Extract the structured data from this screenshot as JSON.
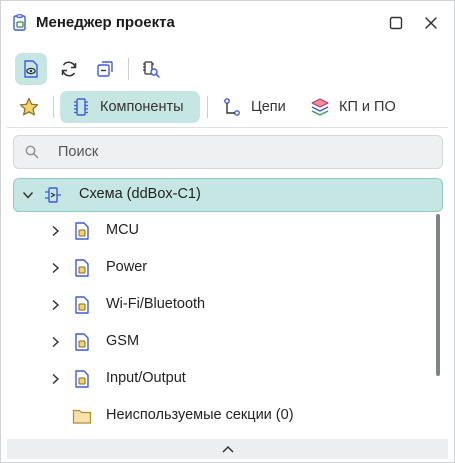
{
  "window": {
    "title": "Менеджер проекта",
    "icons": {
      "app": "project-manager-icon",
      "maximize": "maximize-icon",
      "close": "close-icon"
    }
  },
  "toolbar": {
    "buttons": [
      {
        "name": "view-document-button",
        "icon": "document-eye-icon",
        "active": true
      },
      {
        "name": "refresh-button",
        "icon": "refresh-icon",
        "active": false
      },
      {
        "name": "collapse-all-button",
        "icon": "collapse-icon",
        "active": false
      },
      {
        "name": "component-search-button",
        "icon": "chip-search-icon",
        "active": false
      }
    ]
  },
  "tabs": [
    {
      "label": "",
      "icon": "star-icon",
      "active": false
    },
    {
      "label": "Компоненты",
      "icon": "chip-icon",
      "active": true
    },
    {
      "label": "Цепи",
      "icon": "net-icon",
      "active": false
    },
    {
      "label": "КП и ПО",
      "icon": "layers-icon",
      "active": false
    }
  ],
  "search": {
    "placeholder": "Поиск",
    "value": ""
  },
  "tree": {
    "root": {
      "label": "Схема (ddBox-C1)",
      "expanded": true,
      "icon": "schematic-icon"
    },
    "items": [
      {
        "label": "MCU",
        "icon": "sheet-icon",
        "expandable": true
      },
      {
        "label": "Power",
        "icon": "sheet-icon",
        "expandable": true
      },
      {
        "label": "Wi-Fi/Bluetooth",
        "icon": "sheet-icon",
        "expandable": true
      },
      {
        "label": "GSM",
        "icon": "sheet-icon",
        "expandable": true
      },
      {
        "label": "Input/Output",
        "icon": "sheet-icon",
        "expandable": true
      },
      {
        "label": "Неиспользуемые секции (0)",
        "icon": "folder-icon",
        "expandable": false
      }
    ]
  },
  "colors": {
    "accent": "#c6e6e3",
    "accent_border": "#8fcac4",
    "icon_blue": "#3b5bdb",
    "folder": "#e9c77a"
  }
}
